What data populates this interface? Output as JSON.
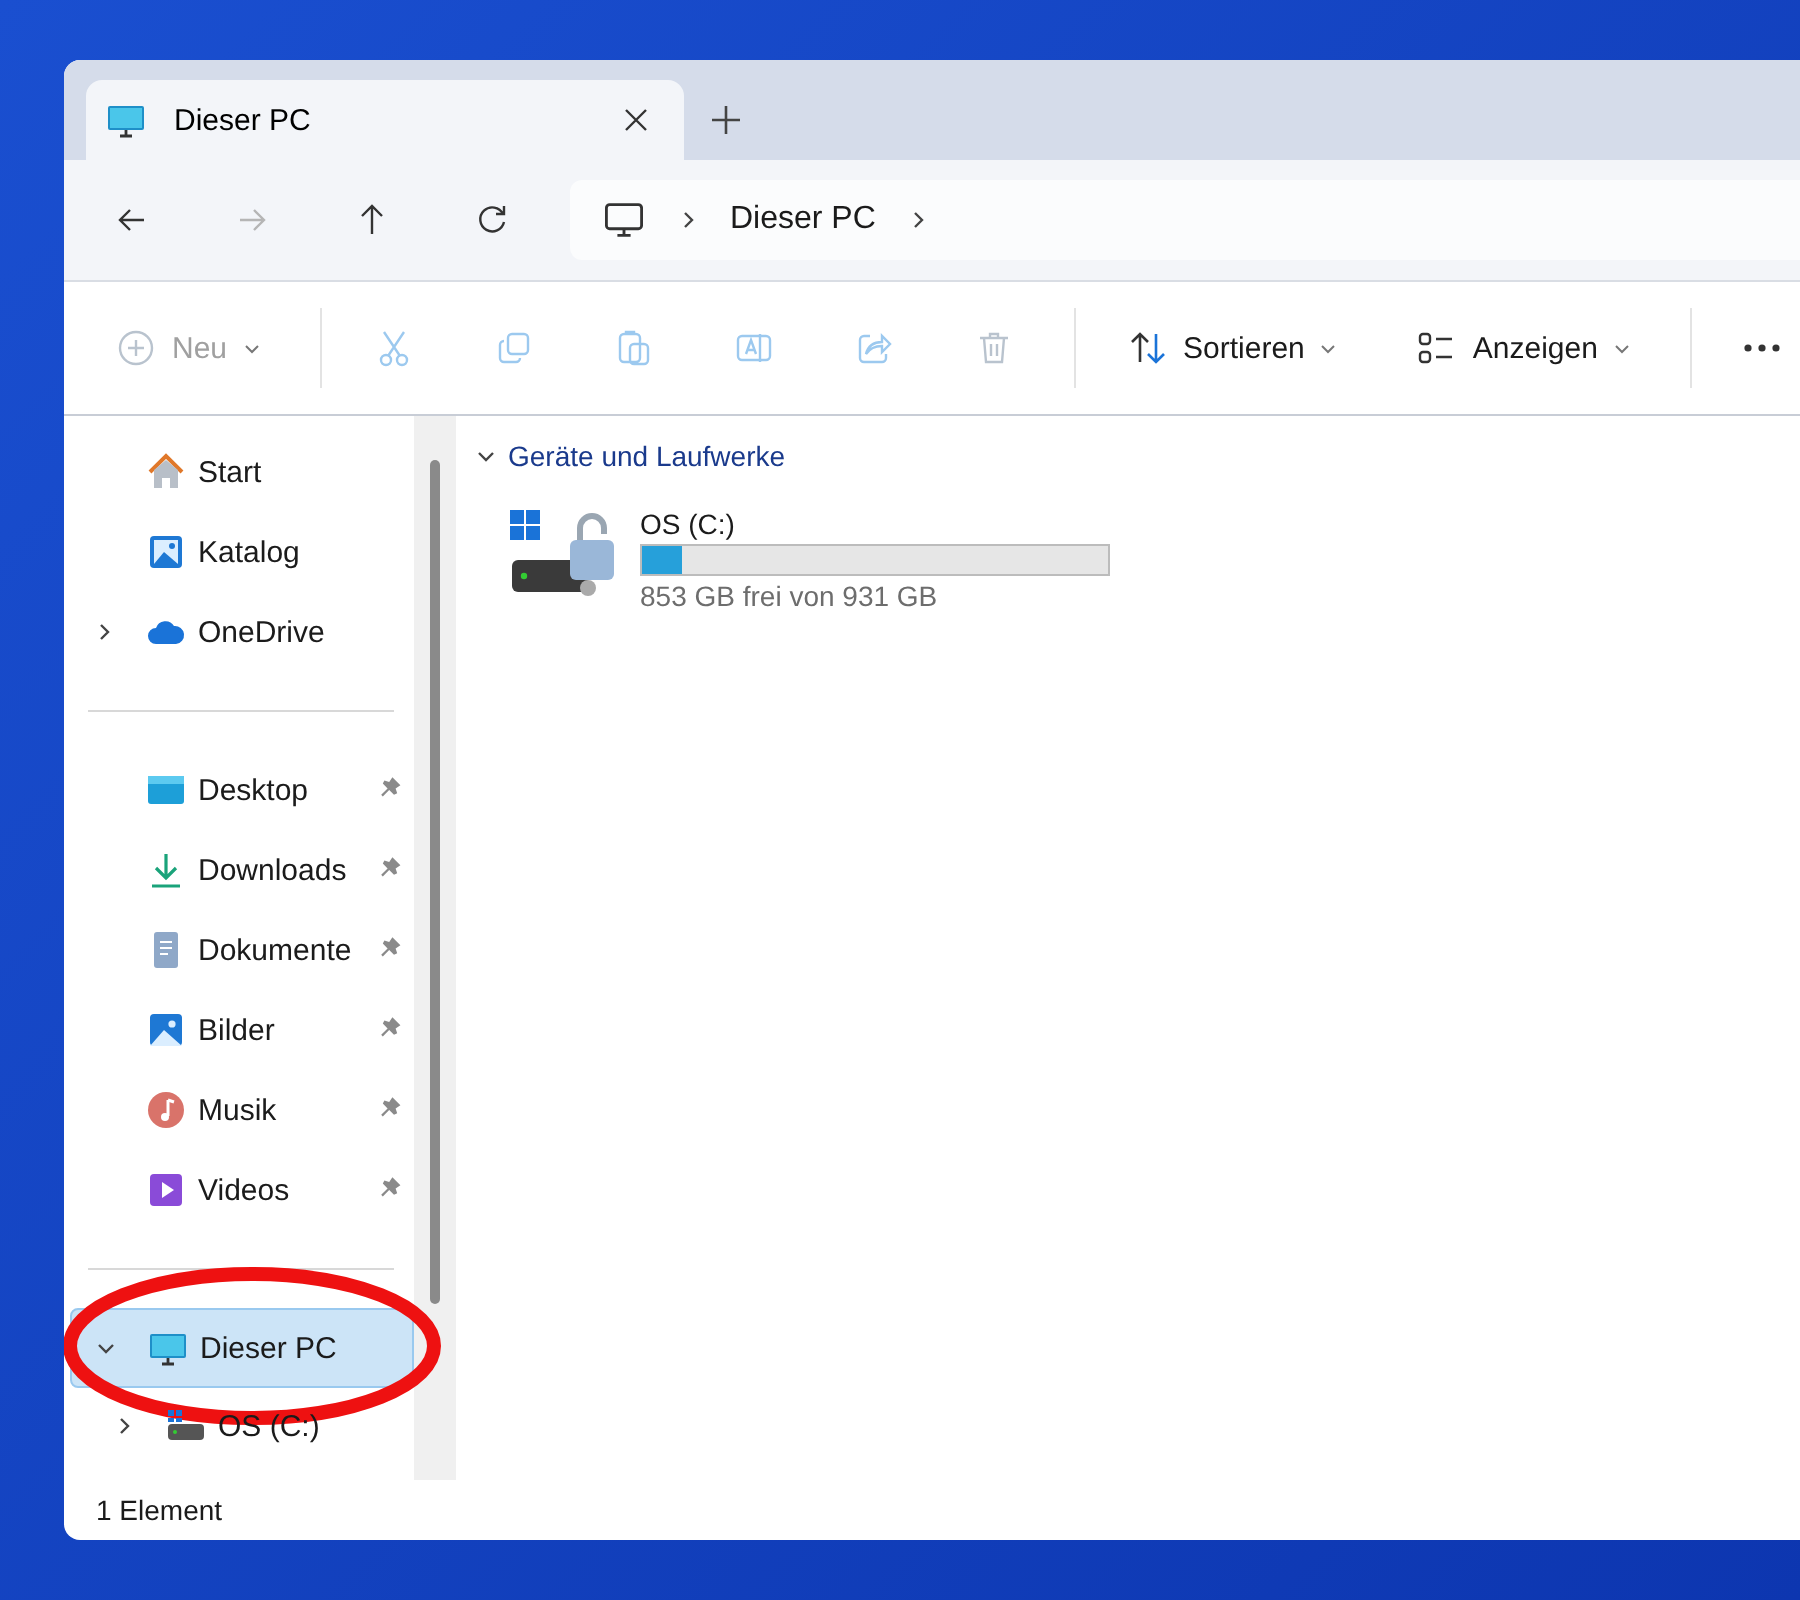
{
  "tabs": [
    {
      "title": "Dieser PC",
      "selected": true
    }
  ],
  "nav": [
    {
      "kind": "back",
      "disabled": false
    },
    {
      "kind": "forward",
      "disabled": true
    },
    {
      "kind": "up",
      "disabled": false
    },
    {
      "kind": "refresh",
      "disabled": false
    }
  ],
  "address_bar": {
    "path": [
      "Dieser PC"
    ]
  },
  "toolbar": [
    {
      "kind": "new",
      "label": "Neu",
      "disabled": true
    },
    {
      "kind": "cut",
      "disabled": true
    },
    {
      "kind": "copy",
      "disabled": true
    },
    {
      "kind": "paste",
      "disabled": true
    },
    {
      "kind": "rename",
      "disabled": true
    },
    {
      "kind": "share",
      "disabled": true
    },
    {
      "kind": "delete",
      "disabled": true
    },
    {
      "kind": "sort",
      "label": "Sortieren",
      "disabled": false
    },
    {
      "kind": "view",
      "label": "Anzeigen",
      "disabled": false
    },
    {
      "kind": "more",
      "disabled": false
    }
  ],
  "sidebar": {
    "top_items": [
      {
        "label": "Start"
      },
      {
        "label": "Katalog"
      },
      {
        "label": "OneDrive",
        "expanded": false
      }
    ],
    "quick_access": [
      {
        "label": "Desktop",
        "pinned": true
      },
      {
        "label": "Downloads",
        "pinned": true
      },
      {
        "label": "Dokumente",
        "pinned": true
      },
      {
        "label": "Bilder",
        "pinned": true
      },
      {
        "label": "Musik",
        "pinned": true
      },
      {
        "label": "Videos",
        "pinned": true
      }
    ],
    "tree": [
      {
        "label": "Dieser PC",
        "expanded": true,
        "selected": true,
        "children": [
          {
            "label": "OS (C:)",
            "expanded": false,
            "selected": false
          }
        ]
      }
    ]
  },
  "content": {
    "group": {
      "title": "Geräte und Laufwerke",
      "expanded": true,
      "drives": [
        {
          "name": "OS (C:)",
          "level": 0.084,
          "reading": "853 GB frei von 931 GB"
        }
      ]
    }
  },
  "status_bar": {
    "text": "1 Element"
  }
}
